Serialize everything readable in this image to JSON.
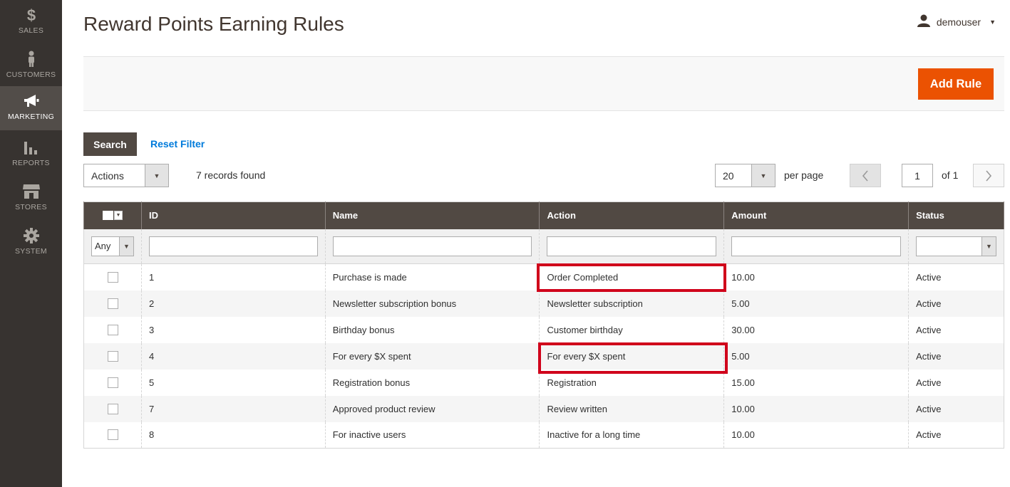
{
  "sidebar": {
    "items": [
      {
        "label": "SALES",
        "icon": "dollar-icon"
      },
      {
        "label": "CUSTOMERS",
        "icon": "person-icon"
      },
      {
        "label": "MARKETING",
        "icon": "megaphone-icon",
        "active": true
      },
      {
        "label": "REPORTS",
        "icon": "bar-chart-icon"
      },
      {
        "label": "STORES",
        "icon": "store-icon"
      },
      {
        "label": "SYSTEM",
        "icon": "gear-icon"
      }
    ]
  },
  "header": {
    "title": "Reward Points Earning Rules",
    "user": "demouser"
  },
  "toolbar": {
    "add_rule_label": "Add Rule",
    "search_label": "Search",
    "reset_filter_label": "Reset Filter",
    "actions_label": "Actions",
    "records_found": "7 records found",
    "per_page_value": "20",
    "per_page_label": "per page",
    "page_current": "1",
    "page_total": "of 1"
  },
  "grid": {
    "columns": [
      "ID",
      "Name",
      "Action",
      "Amount",
      "Status"
    ],
    "filter_any": "Any",
    "rows": [
      {
        "id": "1",
        "name": "Purchase is made",
        "action": "Order Completed",
        "amount": "10.00",
        "status": "Active"
      },
      {
        "id": "2",
        "name": "Newsletter subscription bonus",
        "action": "Newsletter subscription",
        "amount": "5.00",
        "status": "Active"
      },
      {
        "id": "3",
        "name": "Birthday bonus",
        "action": "Customer birthday",
        "amount": "30.00",
        "status": "Active"
      },
      {
        "id": "4",
        "name": "For every $X spent",
        "action": "For every $X spent",
        "amount": "5.00",
        "status": "Active"
      },
      {
        "id": "5",
        "name": "Registration bonus",
        "action": "Registration",
        "amount": "15.00",
        "status": "Active"
      },
      {
        "id": "7",
        "name": "Approved product review",
        "action": "Review written",
        "amount": "10.00",
        "status": "Active"
      },
      {
        "id": "8",
        "name": "For inactive users",
        "action": "Inactive for a long time",
        "amount": "10.00",
        "status": "Active"
      }
    ]
  },
  "colors": {
    "sidebar_bg": "#373330",
    "accent": "#eb5202",
    "grid_header": "#514943",
    "highlight": "#d0021b",
    "link": "#007bdb"
  }
}
